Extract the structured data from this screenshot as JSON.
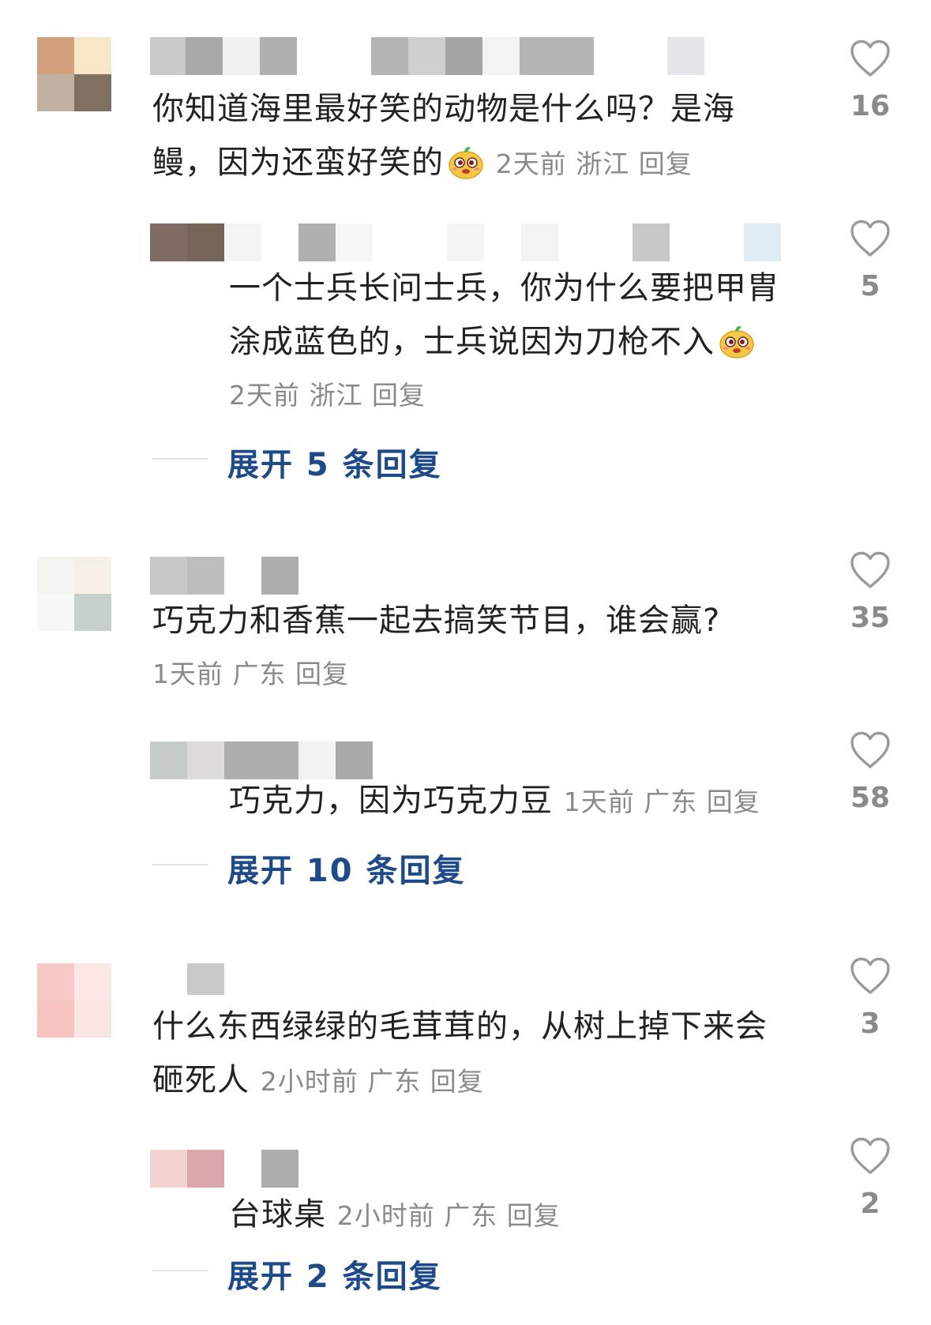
{
  "comments": [
    {
      "text_line1": "你知道海里最好笑的动物是什么吗？是海",
      "text_line2": "鳗，因为还蛮好笑的",
      "meta": "2天前 浙江 回复",
      "likes": "16",
      "reply": {
        "text_line1": "一个士兵长问士兵，你为什么要把甲胄",
        "text_line2": "涂成蓝色的，士兵说因为刀枪不入",
        "meta": "2天前 浙江 回复",
        "likes": "5"
      },
      "expand_label": "展开 5 条回复"
    },
    {
      "text_line1": "巧克力和香蕉一起去搞笑节目，谁会赢?",
      "meta": "1天前 广东 回复",
      "likes": "35",
      "reply": {
        "text_line1": "巧克力，因为巧克力豆",
        "meta": "1天前 广东 回复",
        "likes": "58"
      },
      "expand_label": "展开 10 条回复"
    },
    {
      "text_line1": "什么东西绿绿的毛茸茸的，从树上掉下来会",
      "text_line2": "砸死人",
      "meta": "2小时前 广东 回复",
      "likes": "3",
      "reply": {
        "text_line1": "台球桌",
        "meta": "2小时前 广东 回复",
        "likes": "2"
      },
      "expand_label": "展开 2 条回复"
    }
  ],
  "icons": {
    "like": "heart-outline-icon",
    "emoji": "laughing-emoji-icon"
  },
  "colors": {
    "text": "#222222",
    "meta": "#8a8a8a",
    "expand": "#1e4a8a",
    "heart": "#9a9a9a"
  }
}
